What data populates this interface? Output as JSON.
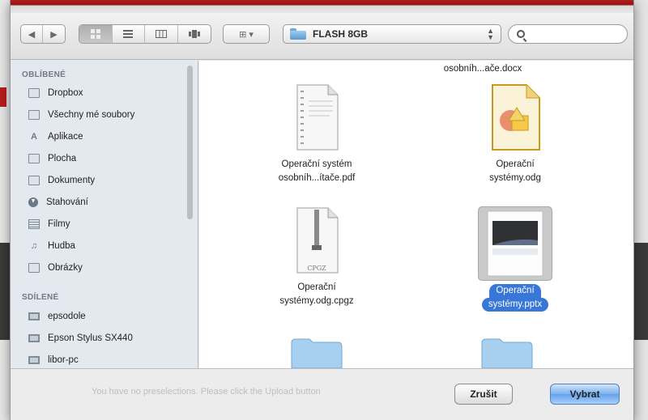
{
  "location": {
    "folder_name": "FLASH 8GB"
  },
  "search": {
    "placeholder": ""
  },
  "toolbar": {
    "nav": [
      "◀",
      "▶"
    ],
    "view_modes": [
      "icon-view",
      "list-view",
      "column-view",
      "coverflow-view"
    ],
    "arrange_label": "⊞ ▾"
  },
  "sidebar": {
    "favorites_header": "OBLÍBENÉ",
    "favorites": [
      {
        "label": "Dropbox",
        "icon": "folder-icon"
      },
      {
        "label": "Všechny mé soubory",
        "icon": "all-files-icon"
      },
      {
        "label": "Aplikace",
        "icon": "applications-icon"
      },
      {
        "label": "Plocha",
        "icon": "desktop-icon"
      },
      {
        "label": "Dokumenty",
        "icon": "documents-icon"
      },
      {
        "label": "Stahování",
        "icon": "downloads-icon"
      },
      {
        "label": "Filmy",
        "icon": "movies-icon"
      },
      {
        "label": "Hudba",
        "icon": "music-icon"
      },
      {
        "label": "Obrázky",
        "icon": "pictures-icon"
      }
    ],
    "shared_header": "SDÍLENÉ",
    "shared": [
      {
        "label": "epsodole",
        "icon": "computer-icon"
      },
      {
        "label": "Epson Stylus SX440",
        "icon": "monitor-icon"
      },
      {
        "label": "libor-pc",
        "icon": "computer-icon"
      }
    ]
  },
  "files": [
    {
      "line1": "osobníh...ače.docx",
      "line2": "",
      "kind": "docx",
      "selected": false
    },
    {
      "line1": "Operační systém",
      "line2": "osobníh...ítače.pdf",
      "kind": "pdf",
      "selected": false
    },
    {
      "line1": "Operační",
      "line2": "systémy.odg",
      "kind": "odg",
      "selected": false
    },
    {
      "line1": "Operační",
      "line2": "systémy.odg.cpgz",
      "kind": "cpgz",
      "selected": false,
      "badge": "CPGZ"
    },
    {
      "line1": "Operační",
      "line2": "systémy.pptx",
      "kind": "pptx",
      "selected": true
    }
  ],
  "bottom": {
    "hint": "You have no preselections. Please click the Upload button",
    "cancel_label": "Zrušit",
    "choose_label": "Vybrat"
  },
  "colors": {
    "selection": "#3877d7",
    "sidebar_bg": "#e4e9ef",
    "accent_red": "#b11e1e"
  }
}
